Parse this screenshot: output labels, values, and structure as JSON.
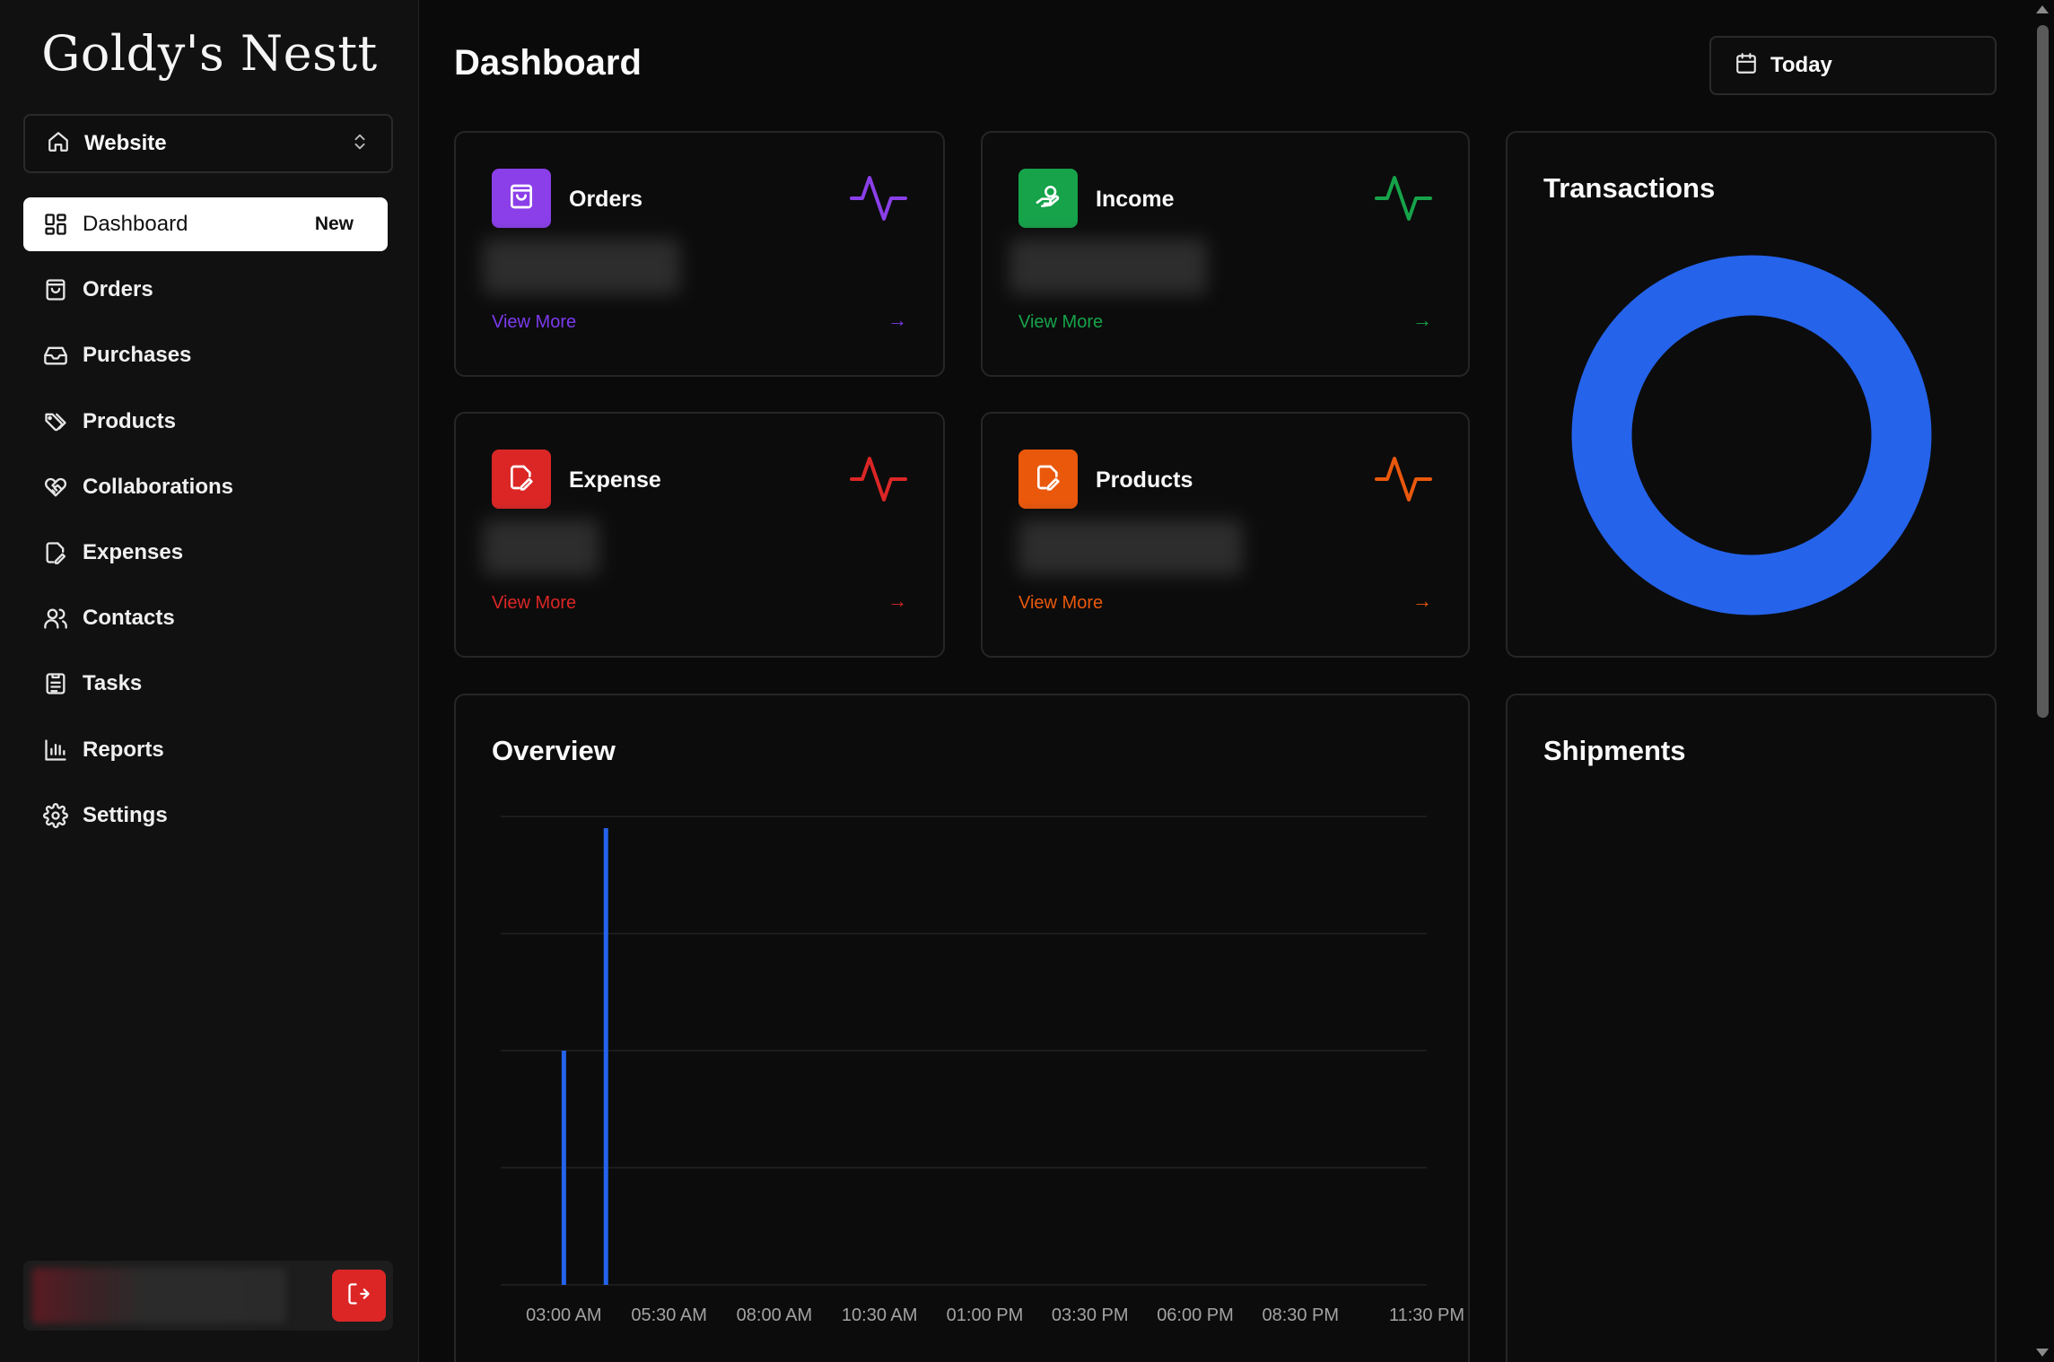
{
  "app": {
    "logo": "Goldy's Nestt"
  },
  "site_select": {
    "label": "Website"
  },
  "nav": [
    {
      "label": "Dashboard",
      "icon": "layout-grid-icon",
      "badge": "New",
      "active": true
    },
    {
      "label": "Orders",
      "icon": "shopping-bag-icon"
    },
    {
      "label": "Purchases",
      "icon": "inbox-icon"
    },
    {
      "label": "Products",
      "icon": "tags-icon"
    },
    {
      "label": "Collaborations",
      "icon": "handshake-icon"
    },
    {
      "label": "Expenses",
      "icon": "file-edit-icon"
    },
    {
      "label": "Contacts",
      "icon": "users-icon"
    },
    {
      "label": "Tasks",
      "icon": "clipboard-list-icon"
    },
    {
      "label": "Reports",
      "icon": "bar-chart-icon"
    },
    {
      "label": "Settings",
      "icon": "settings-icon"
    }
  ],
  "header": {
    "title": "Dashboard",
    "date_filter": "Today"
  },
  "stats": [
    {
      "name": "Orders",
      "icon": "shopping-bag-icon",
      "color": "#8b3fe8",
      "link": "View More",
      "link_color": "#7c3aed"
    },
    {
      "name": "Income",
      "icon": "money-hand-icon",
      "color": "#16a34a",
      "link": "View More",
      "link_color": "#16a34a"
    },
    {
      "name": "Expense",
      "icon": "file-edit-icon",
      "color": "#dc2626",
      "link": "View More",
      "link_color": "#dc2626"
    },
    {
      "name": "Products",
      "icon": "file-edit-icon",
      "color": "#ea580c",
      "link": "View More",
      "link_color": "#ea580c"
    }
  ],
  "transactions": {
    "title": "Transactions",
    "ring_color": "#2563eb"
  },
  "overview": {
    "title": "Overview"
  },
  "shipments": {
    "title": "Shipments"
  },
  "chart_data": {
    "type": "bar",
    "title": "Overview",
    "x_tick_labels": [
      "03:00 AM",
      "05:30 AM",
      "08:00 AM",
      "10:30 AM",
      "01:00 PM",
      "03:30 PM",
      "06:00 PM",
      "08:30 PM",
      "11:30 PM"
    ],
    "series": [
      {
        "values": [
          {
            "x": "03:00 AM",
            "y": 2
          },
          {
            "x": "04:00 AM",
            "y": 3.9
          }
        ]
      }
    ],
    "x_range_hours": [
      1.5,
      23.5
    ],
    "ylim": [
      0,
      4
    ],
    "grid_lines": 4,
    "color": "#2563eb"
  }
}
